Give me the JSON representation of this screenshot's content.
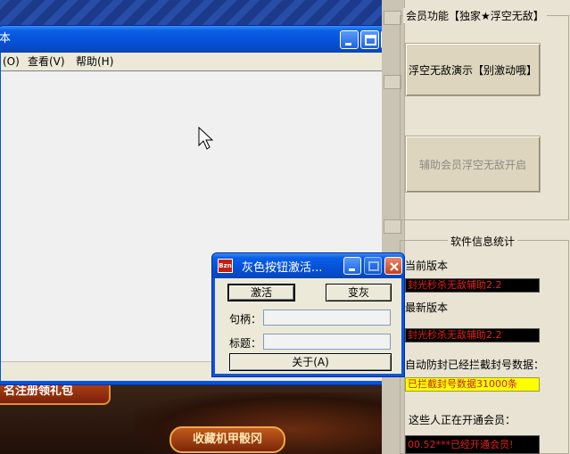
{
  "background": {
    "banner_text": "名注册领礼包",
    "collect_button": "收藏机甲骰冈"
  },
  "notepad": {
    "title": "本",
    "menu": [
      {
        "label": "(O)"
      },
      {
        "label": "查看(V)"
      },
      {
        "label": "帮助(H)"
      }
    ]
  },
  "panel": {
    "member_group_label": "会员功能【独家★浮空无敌】",
    "demo_button": "浮空无敌演示【别激动哦】",
    "assist_button": "辅助会员浮空无敌开启",
    "stats_group_label": "软件信息统计",
    "current_version_label": "当前版本",
    "current_version_value": "封光秒杀无敌辅助2.2",
    "latest_version_label": "最新版本",
    "latest_version_value": "封光秒杀无敌辅助2.2",
    "ban_label": "自动防封已经拦截封号数据：",
    "ban_value": "已拦截封号数据31000条",
    "opening_label": "这些人正在开通会员：",
    "opening_value": "00.52***已经开通会员!"
  },
  "dialog": {
    "title": "灰色按钮激活...",
    "activate_button": "激活",
    "gray_button": "变灰",
    "handle_label": "句柄：",
    "caption_label": "标题：",
    "about_button": "关于(A)"
  },
  "colors": {
    "xp_blue": "#0a5fe6",
    "panel_bg": "#e8e3d2",
    "red_text": "#e5201a",
    "yellow_box": "#ffff00"
  }
}
